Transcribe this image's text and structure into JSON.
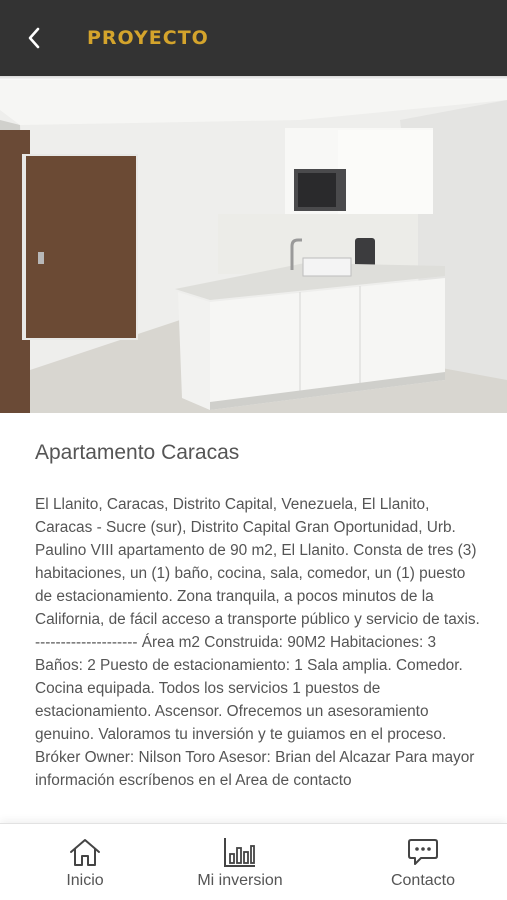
{
  "header": {
    "title": "PROYECTO",
    "back_icon": "chevron-left-icon",
    "background": "#333333",
    "title_color": "#d4a42c"
  },
  "gallery": {
    "image": "apartment-kitchen-photo",
    "slide_count": 4,
    "active_slide": 1
  },
  "property": {
    "title": "Apartamento Caracas",
    "description": "El Llanito, Caracas, Distrito Capital, Venezuela, El Llanito, Caracas - Sucre (sur), Distrito Capital Gran Oportunidad, Urb. Paulino VIII apartamento de 90 m2, El Llanito. Consta de tres (3) habitaciones, un (1) baño, cocina, sala, comedor, un (1) puesto de estacionamiento. Zona tranquila, a pocos minutos de la California, de fácil acceso a transporte público y servicio de taxis. -------------------- Área m2 Construida: 90M2 Habitaciones: 3 Baños: 2 Puesto de estacionamiento: 1 Sala amplia. Comedor. Cocina equipada. Todos los servicios 1 puestos de estacionamiento. Ascensor. Ofrecemos un asesoramiento genuino. Valoramos tu inversión y te guiamos en el proceso. Bróker Owner: Nilson Toro Asesor: Brian del Alcazar Para mayor información escríbenos en el Area de contacto"
  },
  "tabbar": {
    "items": [
      {
        "label": "Inicio",
        "icon": "home-icon"
      },
      {
        "label": "Mi inversion",
        "icon": "bar-chart-icon"
      },
      {
        "label": "Contacto",
        "icon": "chat-icon"
      }
    ]
  }
}
